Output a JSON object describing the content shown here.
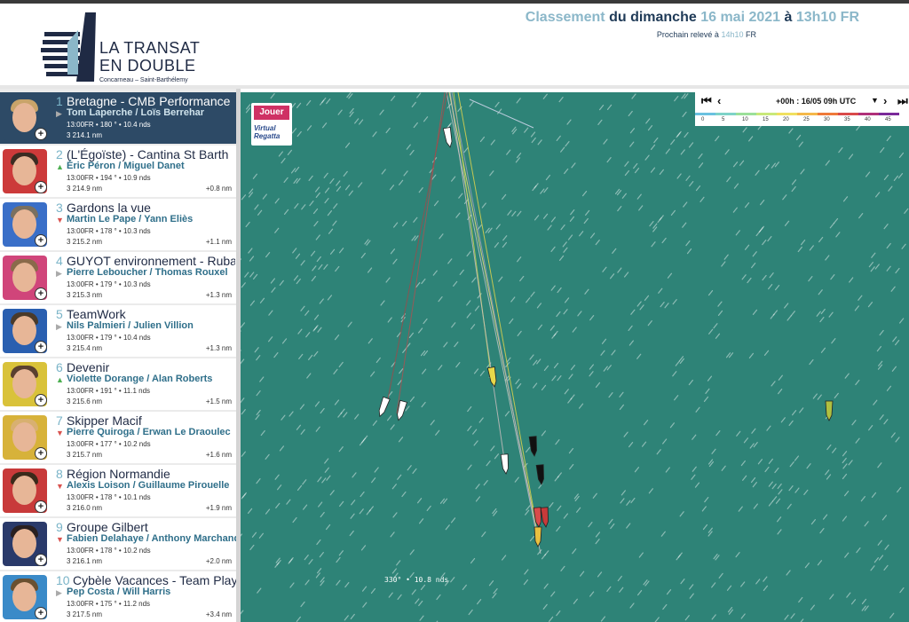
{
  "header": {
    "logo_title_line1": "LA TRANSAT",
    "logo_title_line2": "EN DOUBLE",
    "logo_subtitle": "Concarneau – Saint-Barthélemy",
    "ranking_word": "Classement",
    "ranking_day": " du dimanche ",
    "ranking_date": "16 mai 2021",
    "ranking_at": " à ",
    "ranking_time": "13h10 FR",
    "next_label": "Prochain relevé à",
    "next_time": "14h10",
    "next_tz": "FR"
  },
  "ranking": [
    {
      "rank": "1",
      "name": "Bretagne - CMB Performance",
      "skippers": "Tom Laperche / Loïs Berrehar",
      "info": "13:00FR • 180 ° • 10.4 nds",
      "distance": "3 214.1 nm",
      "gap": "",
      "trend": "none",
      "active": true,
      "color": "#2d4a66",
      "hair": "#c9a46a"
    },
    {
      "rank": "2",
      "name": "(L'Égoïste) - Cantina St Barth",
      "skippers": "Éric Péron / Miguel Danet",
      "info": "13:00FR • 194 ° • 10.9 nds",
      "distance": "3 214.9 nm",
      "gap": "+0.8 nm",
      "trend": "up",
      "active": false,
      "color": "#cc3a3a",
      "hair": "#3b2c22"
    },
    {
      "rank": "3",
      "name": "Gardons la vue",
      "skippers": "Martin Le Pape / Yann Eliès",
      "info": "13:00FR • 178 ° • 10.3 nds",
      "distance": "3 215.2 nm",
      "gap": "+1.1 nm",
      "trend": "down",
      "active": false,
      "color": "#3a6fc8",
      "hair": "#7a7060"
    },
    {
      "rank": "4",
      "name": "GUYOT environnement - Ruban Rose",
      "skippers": "Pierre Leboucher / Thomas Rouxel",
      "info": "13:00FR • 179 ° • 10.3 nds",
      "distance": "3 215.3 nm",
      "gap": "+1.3 nm",
      "trend": "none",
      "active": false,
      "color": "#d0457a",
      "hair": "#8a6a4a"
    },
    {
      "rank": "5",
      "name": "TeamWork",
      "skippers": "Nils Palmieri / Julien Villion",
      "info": "13:00FR • 179 ° • 10.4 nds",
      "distance": "3 215.4 nm",
      "gap": "+1.3 nm",
      "trend": "none",
      "active": false,
      "color": "#2a5fb0",
      "hair": "#4a3a2a"
    },
    {
      "rank": "6",
      "name": "Devenir",
      "skippers": "Violette Dorange / Alan Roberts",
      "info": "13:00FR • 191 ° • 11.1 nds",
      "distance": "3 215.6 nm",
      "gap": "+1.5 nm",
      "trend": "up",
      "active": false,
      "color": "#d9c23a",
      "hair": "#5a4030"
    },
    {
      "rank": "7",
      "name": "Skipper Macif",
      "skippers": "Pierre Quiroga / Erwan Le Draoulec",
      "info": "13:00FR • 177 ° • 10.2 nds",
      "distance": "3 215.7 nm",
      "gap": "+1.6 nm",
      "trend": "down",
      "active": false,
      "color": "#d7b23a",
      "hair": "#d8b070"
    },
    {
      "rank": "8",
      "name": "Région Normandie",
      "skippers": "Alexis Loison / Guillaume Pirouelle",
      "info": "13:00FR • 178 ° • 10.1 nds",
      "distance": "3 216.0 nm",
      "gap": "+1.9 nm",
      "trend": "down",
      "active": false,
      "color": "#c83a3a",
      "hair": "#3a2a1a"
    },
    {
      "rank": "9",
      "name": "Groupe Gilbert",
      "skippers": "Fabien Delahaye / Anthony Marchand",
      "info": "13:00FR • 178 ° • 10.2 nds",
      "distance": "3 216.1 nm",
      "gap": "+2.0 nm",
      "trend": "down",
      "active": false,
      "color": "#2a3a6a",
      "hair": "#2a2020"
    },
    {
      "rank": "10",
      "name": "Cybèle Vacances - Team Play to B",
      "skippers": "Pep Costa / Will Harris",
      "info": "13:00FR • 175 ° • 11.2 nds",
      "distance": "3 217.5 nm",
      "gap": "+3.4 nm",
      "trend": "none",
      "active": false,
      "color": "#3a8ac8",
      "hair": "#6a5030"
    }
  ],
  "map": {
    "play_button": "Jouer",
    "virtual_regatta_line1": "Virtual",
    "virtual_regatta_line2": "Regatta",
    "time_label": "+00h : 16/05 09h UTC",
    "wind_scale": [
      "0",
      "5",
      "10",
      "15",
      "20",
      "25",
      "30",
      "35",
      "40",
      "45"
    ],
    "wind_readout": "330° • 10.8 nds"
  }
}
